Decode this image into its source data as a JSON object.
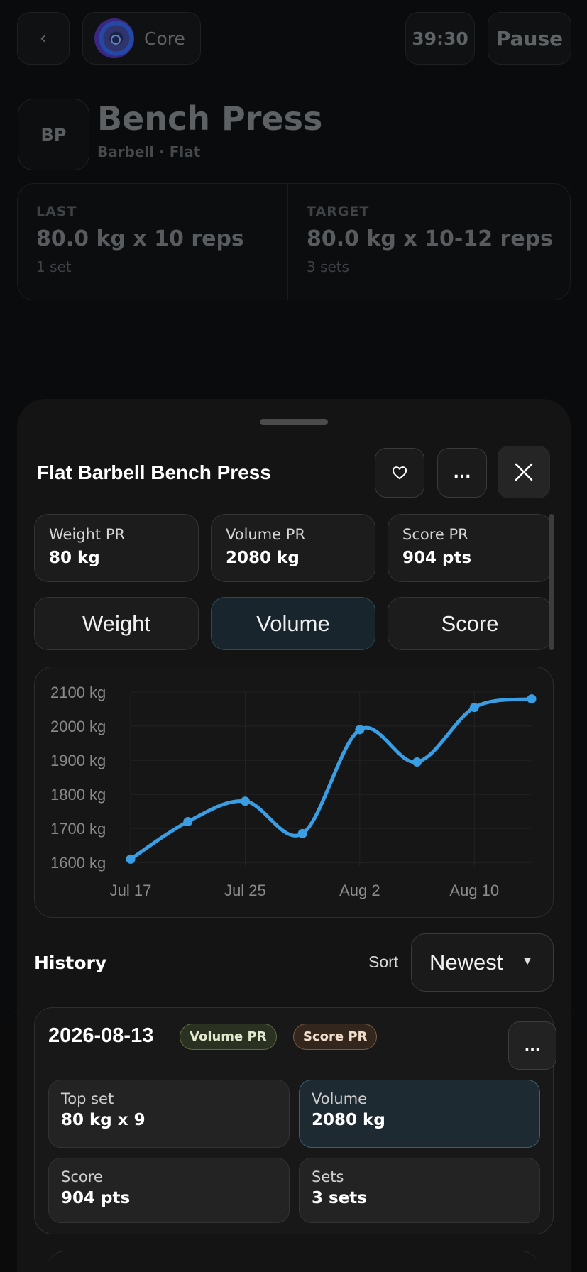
{
  "background": {
    "back_symbol": "‹",
    "program_name": "Core",
    "timer": "39:30",
    "pause_label": "Pause",
    "exercise": {
      "initials": "BP",
      "title": "Bench Press",
      "subtitle": "Barbell · Flat"
    },
    "last": {
      "label": "LAST",
      "value": "80.0 kg x 10 reps",
      "sub": "1 set"
    },
    "target": {
      "label": "TARGET",
      "value": "80.0 kg x 10-12 reps",
      "sub": "3 sets"
    }
  },
  "sheet": {
    "title": "Flat Barbell Bench Press",
    "more_label": "...",
    "prs": [
      {
        "label": "Weight PR",
        "value": "80 kg"
      },
      {
        "label": "Volume PR",
        "value": "2080 kg"
      },
      {
        "label": "Score PR",
        "value": "904 pts"
      }
    ],
    "metric_tabs": [
      "Weight",
      "Volume",
      "Score"
    ],
    "active_metric": "Volume",
    "history": {
      "title": "History",
      "sort_label": "Sort",
      "sort_value": "Newest",
      "entry": {
        "date": "2026-08-13",
        "badges": [
          "Volume PR",
          "Score PR"
        ],
        "more_label": "...",
        "stats": [
          {
            "label": "Top set",
            "value": "80 kg x 9"
          },
          {
            "label": "Volume",
            "value": "2080 kg"
          },
          {
            "label": "Score",
            "value": "904 pts"
          },
          {
            "label": "Sets",
            "value": "3 sets"
          }
        ]
      }
    }
  },
  "colors": {
    "accent_line": "#3a9ee4",
    "active_tab_bg": "#18252d",
    "volume_badge": "#5c6b3e",
    "score_badge": "#7a5a40"
  },
  "chart_data": {
    "type": "line",
    "x_start": "Jul 17",
    "x_tick_labels": [
      "Jul 17",
      "Jul 25",
      "Aug 2",
      "Aug 10"
    ],
    "x_tick_days": [
      0,
      8,
      16,
      24
    ],
    "y_unit": "kg",
    "y_ticks": [
      1600,
      1700,
      1800,
      1900,
      2000,
      2100
    ],
    "ylim": [
      1590,
      2100
    ],
    "series": [
      {
        "x_days": [
          0,
          4,
          8,
          12,
          16,
          20,
          24,
          28
        ],
        "values": [
          1610,
          1720,
          1780,
          1685,
          1990,
          1895,
          2055,
          2080
        ]
      }
    ],
    "grid": true,
    "legend": "none"
  }
}
